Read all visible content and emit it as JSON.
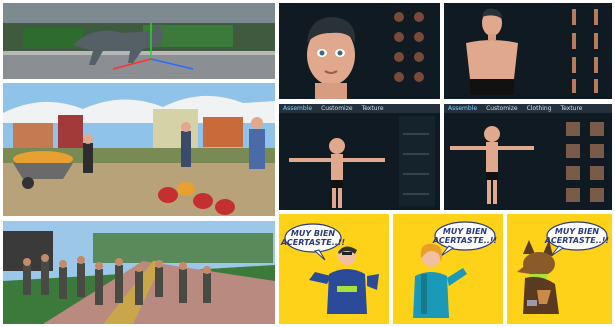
{
  "thumbnails": [
    {
      "name": "wolf-scene"
    },
    {
      "name": "character-head-closeup"
    },
    {
      "name": "character-body-closeup"
    },
    {
      "name": "farm-market-scene"
    },
    {
      "name": "character-tpose-1"
    },
    {
      "name": "character-tpose-2"
    },
    {
      "name": "zombie-crowd-scene"
    },
    {
      "name": "comic-panel-hero"
    },
    {
      "name": "comic-panel-heroine"
    },
    {
      "name": "comic-panel-dog"
    }
  ],
  "editor_tabs_1": [
    "Assemble",
    "Customize",
    "Texture"
  ],
  "editor_tabs_2": [
    "Assemble",
    "Customize",
    "Clothing",
    "Texture"
  ],
  "comic_bubbles": {
    "hero": [
      "MUY BIEN",
      "ACERTASTE..!!"
    ],
    "heroine": [
      "MUY BIEN",
      "ACERTASTE..!!"
    ],
    "dog": [
      "MUY BIEN",
      "ACERTASTE..!!"
    ]
  },
  "colors": {
    "comic_yellow": "#ffd21a",
    "editor_dark": "#0f1a22",
    "sky_blue": "#8fc3ea"
  }
}
